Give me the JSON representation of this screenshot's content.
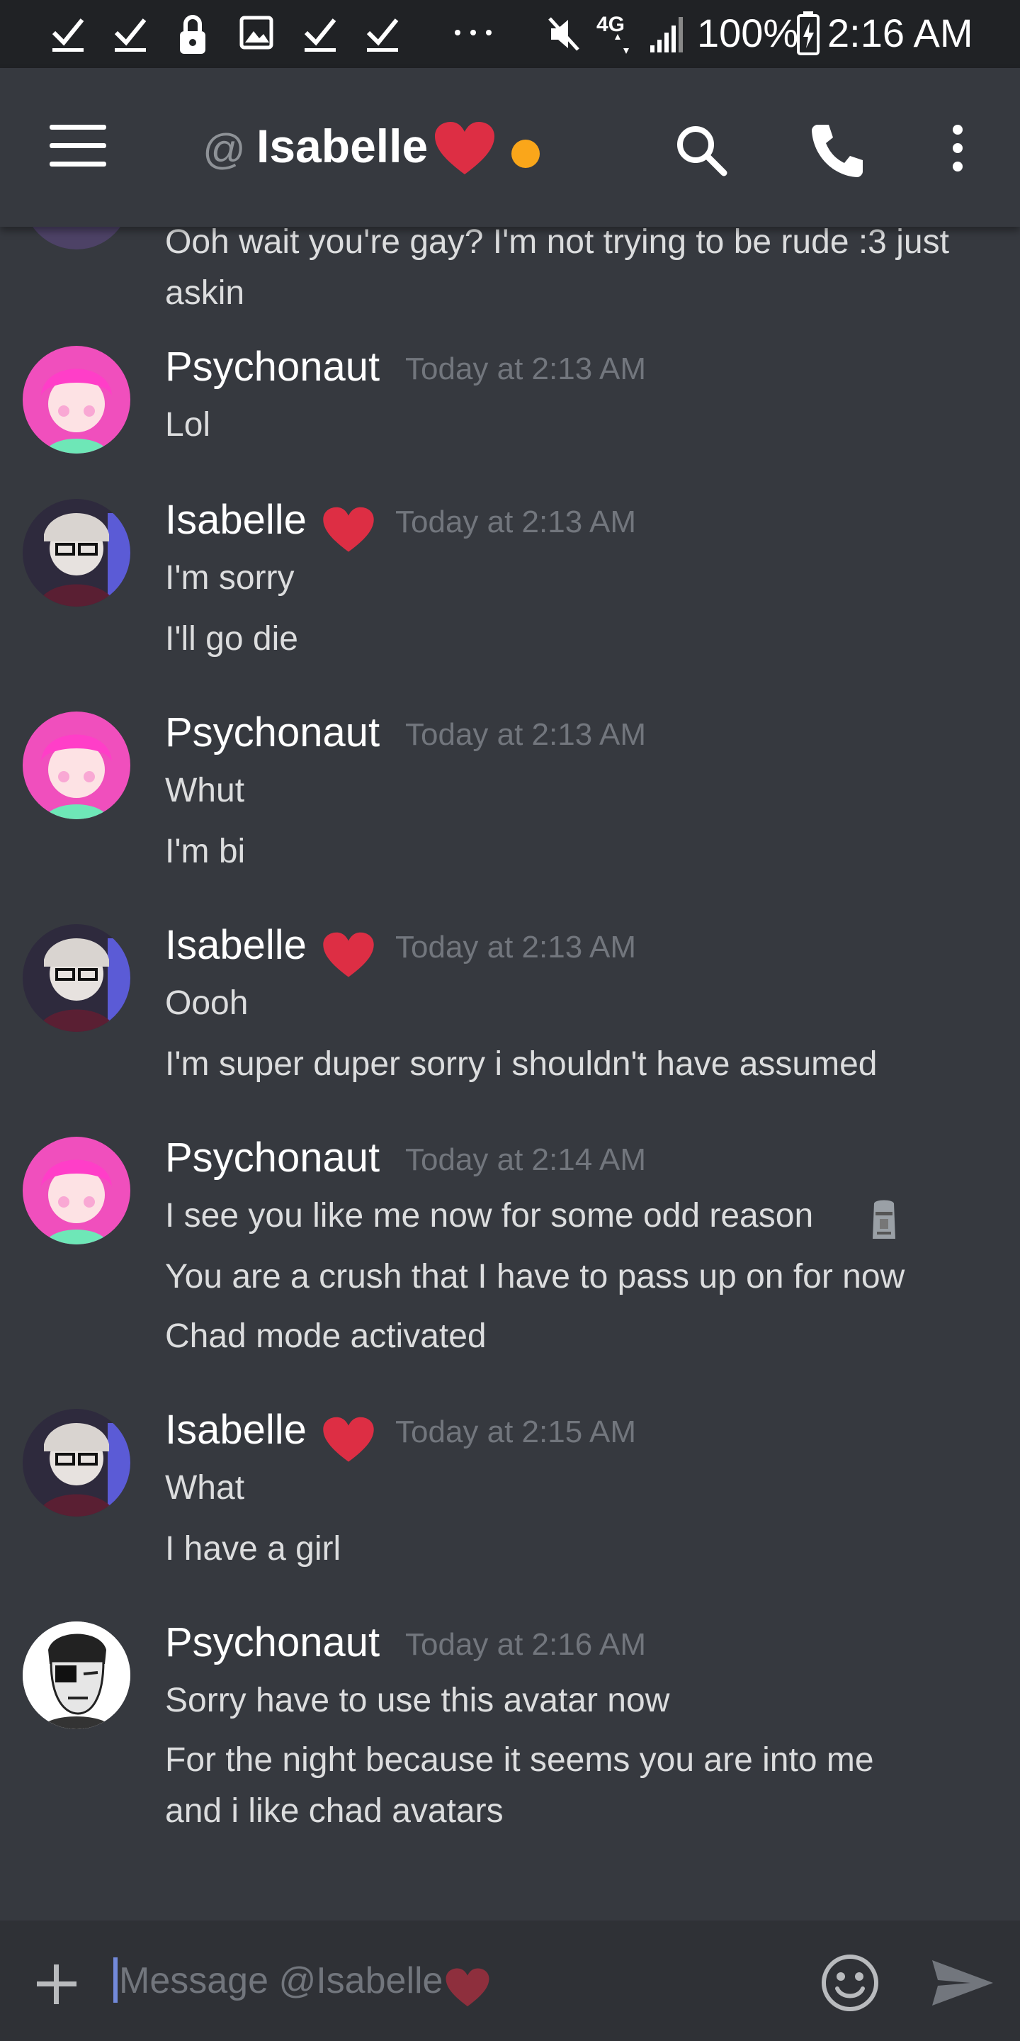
{
  "status_bar": {
    "battery": "100%",
    "time": "2:16 AM",
    "network": "4G",
    "icons": [
      "check-icon",
      "check-icon",
      "lock-icon",
      "image-icon",
      "check-icon",
      "check-icon",
      "more-dots-icon",
      "mute-icon",
      "network-icon",
      "signal-icon",
      "battery-icon"
    ]
  },
  "header": {
    "at_symbol": "@",
    "channel_name": "Isabelle",
    "heart_emoji": "heart-emoji",
    "presence_color": "#faa61a",
    "icons": [
      "menu-icon",
      "search-icon",
      "phone-icon",
      "more-vertical-icon"
    ]
  },
  "colors": {
    "background": "#36393f",
    "header_bg": "#36393f",
    "status_bar_bg": "#202225",
    "input_bg": "#2f3136",
    "timestamp": "#72767d",
    "accent": "#7289da",
    "heart": "#dd2e44"
  },
  "continued_message": {
    "text": "Ooh wait you're gay? I'm not trying to be rude :3 just askin"
  },
  "messages": [
    {
      "author": "Psychonaut",
      "avatar": "pink-hair-avatar",
      "timestamp": "Today at 2:13 AM",
      "lines": [
        "Lol"
      ]
    },
    {
      "author": "Isabelle",
      "avatar": "glasses-avatar",
      "timestamp": "Today at 2:13 AM",
      "lines": [
        "I'm sorry",
        "I'll go die"
      ]
    },
    {
      "author": "Psychonaut",
      "avatar": "pink-hair-avatar",
      "timestamp": "Today at 2:13 AM",
      "lines": [
        "Whut",
        "I'm bi"
      ]
    },
    {
      "author": "Isabelle",
      "avatar": "glasses-avatar",
      "timestamp": "Today at 2:13 AM",
      "lines": [
        "Oooh",
        "I'm super duper sorry i shouldn't have assumed"
      ]
    },
    {
      "author": "Psychonaut",
      "avatar": "pink-hair-avatar",
      "timestamp": "Today at 2:14 AM",
      "lines": [
        "I see you like me now for some odd reason",
        "You are a crush that I have to pass up on for now",
        "Chad mode activated"
      ]
    },
    {
      "author": "Isabelle",
      "avatar": "glasses-avatar",
      "timestamp": "Today at 2:15 AM",
      "lines": [
        "What",
        "I have a girl"
      ]
    },
    {
      "author": "Psychonaut",
      "avatar": "chad-avatar",
      "timestamp": "Today at 2:16 AM",
      "lines": [
        "Sorry have to use this avatar now",
        "For the night because it seems you are into me",
        "and i like chad avatars"
      ]
    }
  ],
  "composer": {
    "placeholder": "Message @Isabelle",
    "icons": [
      "plus-icon",
      "emoji-icon",
      "send-icon"
    ]
  }
}
